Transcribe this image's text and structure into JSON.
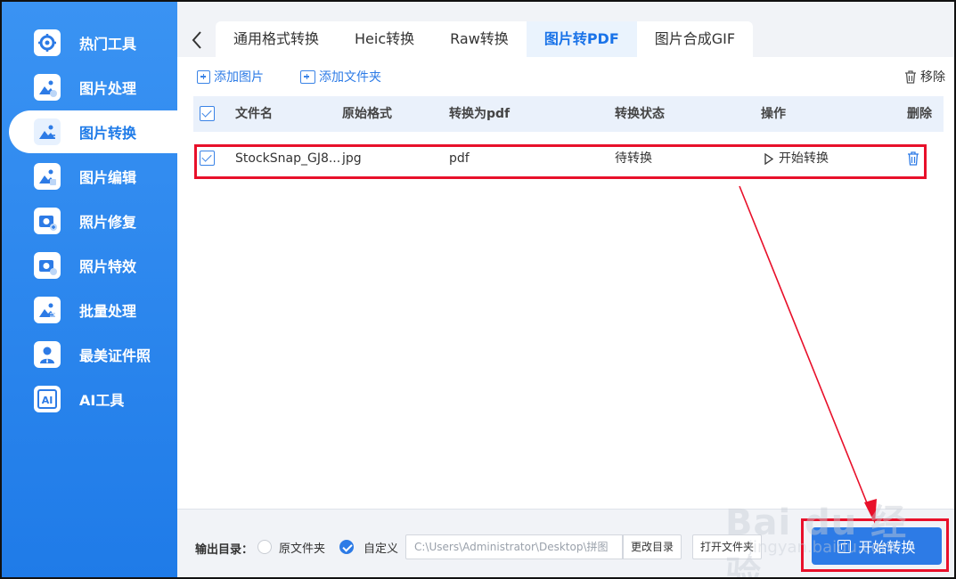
{
  "sidebar": {
    "items": [
      {
        "label": "热门工具",
        "icon": "settings-icon"
      },
      {
        "label": "图片处理",
        "icon": "image-process-icon"
      },
      {
        "label": "图片转换",
        "icon": "image-convert-icon",
        "active": true
      },
      {
        "label": "图片编辑",
        "icon": "image-edit-icon"
      },
      {
        "label": "照片修复",
        "icon": "photo-repair-icon"
      },
      {
        "label": "照片特效",
        "icon": "photo-effect-icon"
      },
      {
        "label": "批量处理",
        "icon": "batch-icon"
      },
      {
        "label": "最美证件照",
        "icon": "id-photo-icon"
      },
      {
        "label": "AI工具",
        "icon": "ai-icon"
      }
    ]
  },
  "tabs": [
    {
      "label": "通用格式转换"
    },
    {
      "label": "Heic转换"
    },
    {
      "label": "Raw转换"
    },
    {
      "label": "图片转PDF",
      "active": true
    },
    {
      "label": "图片合成GIF"
    }
  ],
  "toolbar": {
    "add_image": "添加图片",
    "add_folder": "添加文件夹",
    "remove": "移除"
  },
  "table": {
    "headers": {
      "filename": "文件名",
      "orig_format": "原始格式",
      "convert_to": "转换为pdf",
      "status": "转换状态",
      "action": "操作",
      "delete": "删除"
    },
    "rows": [
      {
        "filename": "StockSnap_GJ8...",
        "orig_format": "jpg",
        "convert_to": "pdf",
        "status": "待转换",
        "action": "开始转换"
      }
    ]
  },
  "bottom": {
    "output_label": "输出目录：",
    "option_original": "原文件夹",
    "option_custom": "自定义",
    "path": "C:\\Users\\Administrator\\Desktop\\拼图",
    "change_dir": "更改目录",
    "open_folder": "打开文件夹",
    "start": "开始转换"
  },
  "watermark": {
    "big": "Bai du 经验",
    "small": "jingyan.baidu.com"
  },
  "colors": {
    "sidebar": "#2d8cf0",
    "accent": "#2d7be6",
    "highlight": "#e8102a"
  }
}
